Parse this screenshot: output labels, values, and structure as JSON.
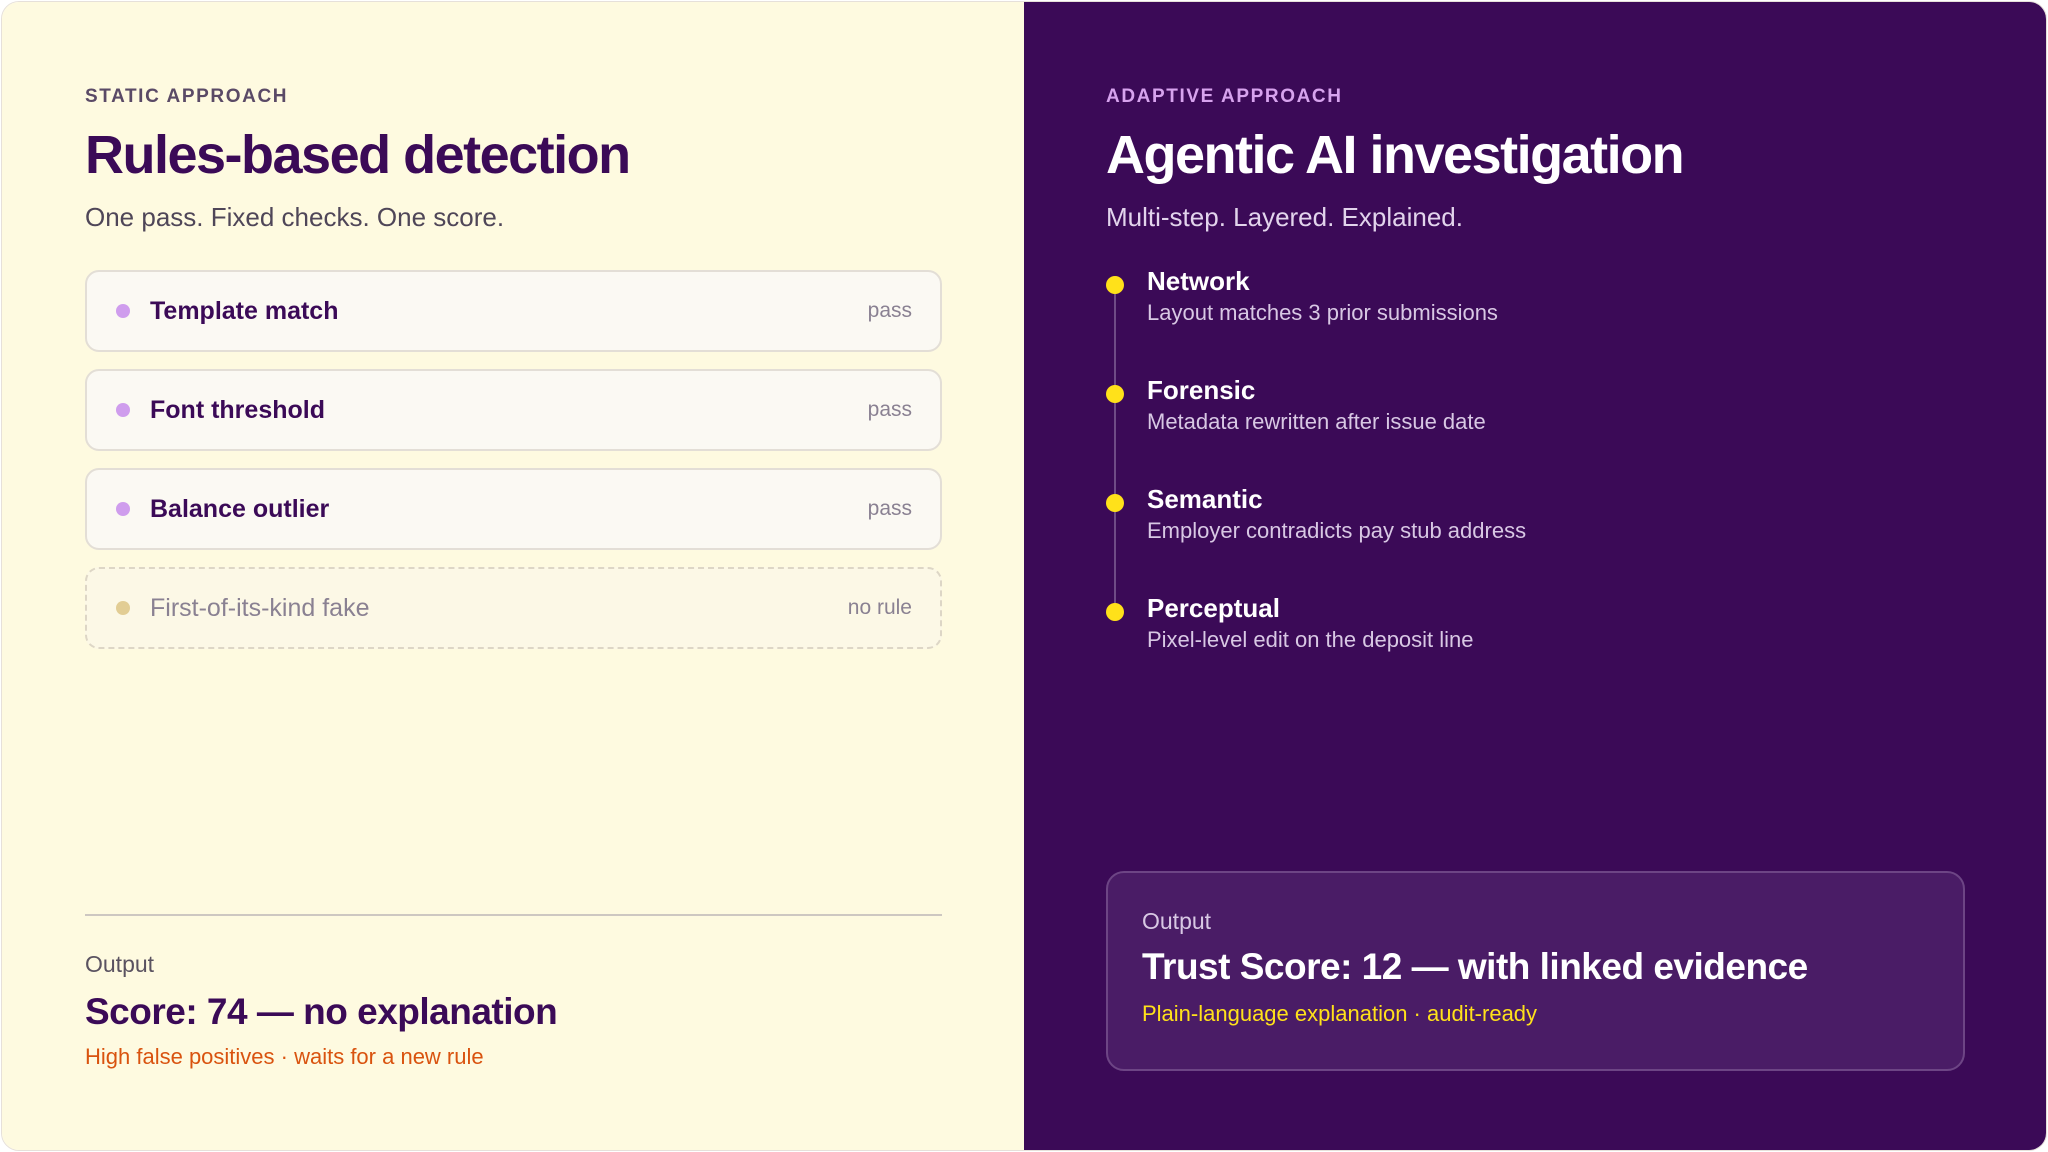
{
  "static": {
    "eyebrow": "STATIC APPROACH",
    "title": "Rules-based detection",
    "subtitle": "One pass. Fixed checks. One score.",
    "rules": [
      {
        "label": "Template match",
        "status": "pass"
      },
      {
        "label": "Font threshold",
        "status": "pass"
      },
      {
        "label": "Balance outlier",
        "status": "pass"
      },
      {
        "label": "First-of-its-kind fake",
        "status": "no rule"
      }
    ],
    "output": {
      "label": "Output",
      "value": "Score: 74 — no explanation",
      "note": "High false positives · waits for a new rule"
    }
  },
  "adaptive": {
    "eyebrow": "ADAPTIVE APPROACH",
    "title": "Agentic AI investigation",
    "subtitle": "Multi-step. Layered. Explained.",
    "steps": [
      {
        "title": "Network",
        "desc": "Layout matches 3 prior submissions"
      },
      {
        "title": "Forensic",
        "desc": "Metadata rewritten after issue date"
      },
      {
        "title": "Semantic",
        "desc": "Employer contradicts pay stub address"
      },
      {
        "title": "Perceptual",
        "desc": "Pixel-level edit on the deposit line"
      }
    ],
    "output": {
      "label": "Output",
      "value": "Trust Score: 12 — with linked evidence",
      "note": "Plain-language explanation · audit-ready"
    }
  },
  "colors": {
    "left_bg": "#fefae0",
    "right_bg": "#3b0a57",
    "accent_purple": "#3b0a57",
    "accent_yellow": "#ffe11a",
    "accent_orange": "#d9530f"
  }
}
